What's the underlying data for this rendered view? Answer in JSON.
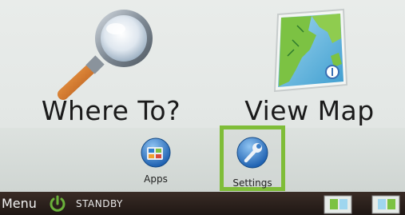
{
  "main_menu": {
    "where_to_label": "Where To?",
    "view_map_label": "View Map"
  },
  "shortcuts": {
    "apps_label": "Apps",
    "settings_label": "Settings"
  },
  "bottom_bar": {
    "menu_label": "Menu",
    "status_label": "STANDBY"
  },
  "colors": {
    "highlight": "#7fbd38",
    "power_icon": "#6ab13a"
  },
  "icons": [
    "magnifier-icon",
    "map-icon",
    "apps-icon",
    "wrench-icon",
    "power-icon",
    "route-thumbnail-icon"
  ]
}
